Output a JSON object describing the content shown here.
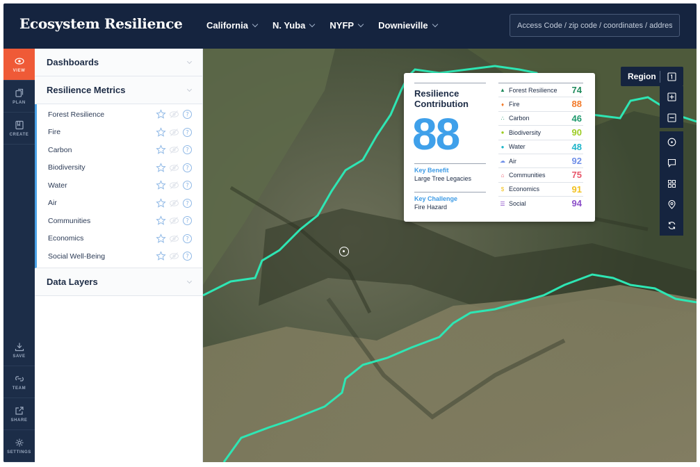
{
  "app": {
    "title": "Ecosystem Resilience",
    "search_placeholder": "Access Code / zip code / coordinates / address"
  },
  "breadcrumbs": [
    {
      "label": "California"
    },
    {
      "label": "N. Yuba"
    },
    {
      "label": "NYFP"
    },
    {
      "label": "Downieville"
    }
  ],
  "rail": {
    "view": "VIEW",
    "plan": "PLAN",
    "create": "CREATE",
    "save": "SAVE",
    "team": "TEAM",
    "share": "SHARE",
    "settings": "SETTINGS"
  },
  "panel": {
    "dashboards": "Dashboards",
    "resilience_metrics": "Resilience Metrics",
    "data_layers": "Data Layers",
    "metrics": [
      {
        "label": "Forest Resilience"
      },
      {
        "label": "Fire"
      },
      {
        "label": "Carbon"
      },
      {
        "label": "Biodiversity"
      },
      {
        "label": "Water"
      },
      {
        "label": "Air"
      },
      {
        "label": "Communities"
      },
      {
        "label": "Economics"
      },
      {
        "label": "Social Well-Being"
      }
    ]
  },
  "card": {
    "title": "Resilience Contribution",
    "score": "88",
    "key_benefit_label": "Key Benefit",
    "key_benefit": "Large Tree Legacies",
    "key_challenge_label": "Key Challenge",
    "key_challenge": "Fire Hazard",
    "scores": [
      {
        "label": "Forest Resilience",
        "value": "74",
        "color": "#1f8a5c",
        "icon": "tree-icon"
      },
      {
        "label": "Fire",
        "value": "88",
        "color": "#f27a2a",
        "icon": "flame-icon"
      },
      {
        "label": "Carbon",
        "value": "46",
        "color": "#1f9a6e",
        "icon": "molecule-icon"
      },
      {
        "label": "Biodiversity",
        "value": "90",
        "color": "#9ccc23",
        "icon": "leaf-icon"
      },
      {
        "label": "Water",
        "value": "48",
        "color": "#1fb5c9",
        "icon": "droplet-icon"
      },
      {
        "label": "Air",
        "value": "92",
        "color": "#6f8fe8",
        "icon": "cloud-icon"
      },
      {
        "label": "Communities",
        "value": "75",
        "color": "#e8566a",
        "icon": "house-icon"
      },
      {
        "label": "Economics",
        "value": "91",
        "color": "#f2c11f",
        "icon": "dollar-icon"
      },
      {
        "label": "Social",
        "value": "94",
        "color": "#8c4fc9",
        "icon": "people-icon"
      }
    ]
  },
  "map_controls": {
    "region_label": "Region"
  },
  "colors": {
    "header": "#15243f",
    "accent_active": "#ef5a37",
    "accent_blue": "#3fa0ea",
    "boundary": "#2ee6b4"
  }
}
